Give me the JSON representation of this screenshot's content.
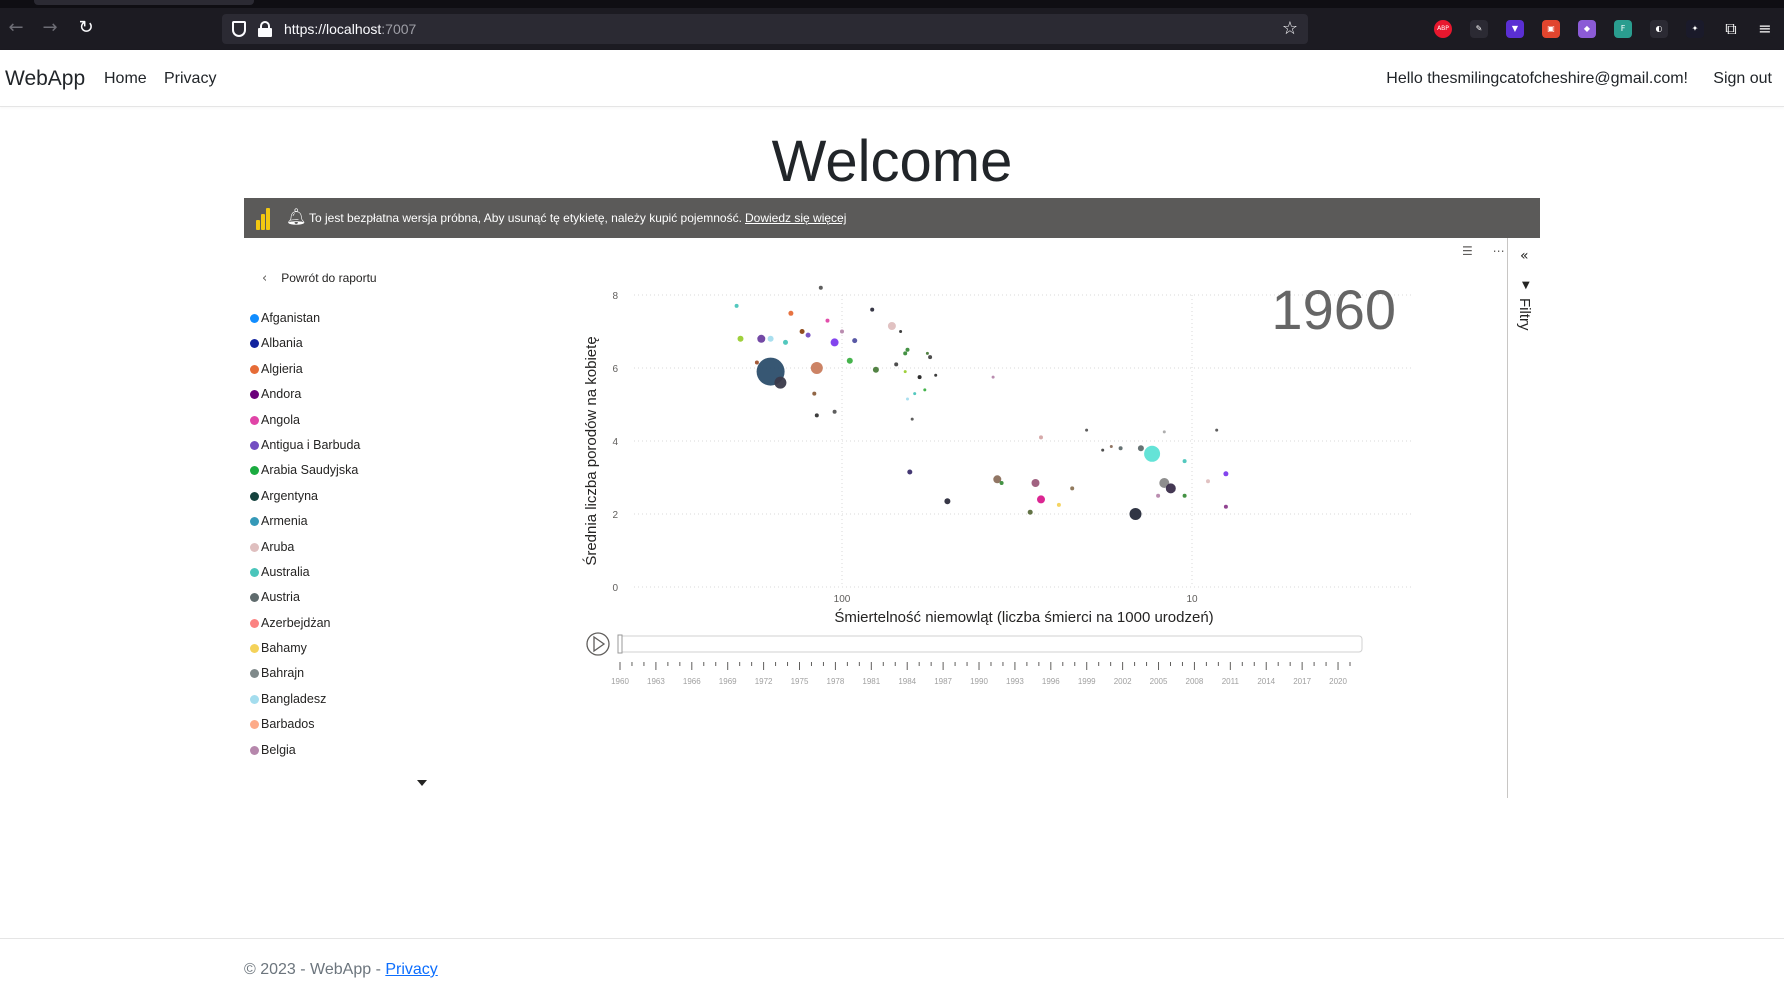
{
  "browser": {
    "url_host": "https://localhost",
    "url_port": ":7007",
    "back_icon": "arrow-left-icon",
    "forward_icon": "arrow-right-icon",
    "reload_icon": "reload-icon",
    "extensions": [
      {
        "name": "adblock-plus-icon",
        "label": "ABP",
        "color": "#e8172e"
      },
      {
        "name": "pen-icon",
        "label": "✎",
        "color": "#2b2a33"
      },
      {
        "name": "proton-icon",
        "label": "▼",
        "color": "#5a2fd3"
      },
      {
        "name": "screenshot-icon",
        "label": "▣",
        "color": "#e1452e"
      },
      {
        "name": "cube-icon",
        "label": "◆",
        "color": "#8b5bd6"
      },
      {
        "name": "shield-f-icon",
        "label": "F",
        "color": "#2a9d8f"
      },
      {
        "name": "circle-arrow-icon",
        "label": "◐",
        "color": "#2b2a33"
      },
      {
        "name": "sparkle-icon",
        "label": "✦",
        "color": "#1a1a2a"
      },
      {
        "name": "puzzle-icon",
        "label": "⧉",
        "color": "#1c1b22"
      },
      {
        "name": "menu-icon",
        "label": "≡",
        "color": "#1c1b22"
      }
    ]
  },
  "navbar": {
    "brand": "WebApp",
    "links": [
      "Home",
      "Privacy"
    ],
    "greeting": "Hello thesmilingcatofcheshire@gmail.com!",
    "signout": "Sign out"
  },
  "page": {
    "title": "Welcome"
  },
  "report": {
    "banner_message": "To jest bezpłatna wersja próbna, Aby usunąć tę etykietę, należy kupić pojemność.",
    "banner_link": "Dowiedz się więcej",
    "back_label": "Powrót do raportu",
    "filters_label": "Filtry",
    "legend": [
      {
        "name": "Afganistan",
        "color": "#118dff"
      },
      {
        "name": "Albania",
        "color": "#12239e"
      },
      {
        "name": "Algieria",
        "color": "#e66c37"
      },
      {
        "name": "Andora",
        "color": "#6b007b"
      },
      {
        "name": "Angola",
        "color": "#e044a7"
      },
      {
        "name": "Antigua i Barbuda",
        "color": "#744ec2"
      },
      {
        "name": "Arabia Saudyjska",
        "color": "#1aab40"
      },
      {
        "name": "Argentyna",
        "color": "#15433e"
      },
      {
        "name": "Armenia",
        "color": "#3599b8"
      },
      {
        "name": "Aruba",
        "color": "#dfbfbf"
      },
      {
        "name": "Australia",
        "color": "#4ac5bb"
      },
      {
        "name": "Austria",
        "color": "#5f6b6d"
      },
      {
        "name": "Azerbejdżan",
        "color": "#fb8281"
      },
      {
        "name": "Bahamy",
        "color": "#f4d25a"
      },
      {
        "name": "Bahrajn",
        "color": "#7f898a"
      },
      {
        "name": "Bangladesz",
        "color": "#a4ddee"
      },
      {
        "name": "Barbados",
        "color": "#fdab89"
      },
      {
        "name": "Belgia",
        "color": "#b687ac"
      }
    ]
  },
  "chart_data": {
    "type": "scatter",
    "year_label": "1960",
    "xlabel": "Śmiertelność niemowląt (liczba śmierci na 1000 urodzeń)",
    "ylabel": "Średnia liczba porodów na kobietę",
    "x_scale": "log (reversed)",
    "x_ticks": [
      "100",
      "10"
    ],
    "y_ticks": [
      "0",
      "2",
      "4",
      "6",
      "8"
    ],
    "ylim": [
      0,
      8
    ],
    "xlim_note": "reversed log axis, approx 300 to 1.3",
    "timeline_years": [
      "1960",
      "1963",
      "1966",
      "1969",
      "1972",
      "1975",
      "1978",
      "1981",
      "1984",
      "1987",
      "1990",
      "1993",
      "1996",
      "1999",
      "2002",
      "2005",
      "2008",
      "2011",
      "2014",
      "2017",
      "2020"
    ],
    "points": [
      {
        "x": 160,
        "y": 5.9,
        "r": 14,
        "c": "#2c4e6b"
      },
      {
        "x": 150,
        "y": 5.6,
        "r": 6,
        "c": "#3a3a4a"
      },
      {
        "x": 118,
        "y": 6.0,
        "r": 6,
        "c": "#c97c5d"
      },
      {
        "x": 170,
        "y": 6.8,
        "r": 4,
        "c": "#6b3fa0"
      },
      {
        "x": 195,
        "y": 6.8,
        "r": 3,
        "c": "#9acd32"
      },
      {
        "x": 160,
        "y": 6.8,
        "r": 3,
        "c": "#a4ddee"
      },
      {
        "x": 105,
        "y": 6.7,
        "r": 4,
        "c": "#7c3aed"
      },
      {
        "x": 95,
        "y": 6.2,
        "r": 3,
        "c": "#3cb043"
      },
      {
        "x": 80,
        "y": 5.95,
        "r": 3,
        "c": "#4a7c3a"
      },
      {
        "x": 72,
        "y": 7.15,
        "r": 4,
        "c": "#dfbfbf"
      },
      {
        "x": 92,
        "y": 6.75,
        "r": 2.5,
        "c": "#5050a0"
      },
      {
        "x": 140,
        "y": 7.5,
        "r": 2.5,
        "c": "#e66c37"
      },
      {
        "x": 115,
        "y": 8.2,
        "r": 2,
        "c": "#555"
      },
      {
        "x": 130,
        "y": 7.0,
        "r": 2.5,
        "c": "#8b4513"
      },
      {
        "x": 145,
        "y": 6.7,
        "r": 2.5,
        "c": "#4ac5bb"
      },
      {
        "x": 125,
        "y": 6.9,
        "r": 2.5,
        "c": "#744ec2"
      },
      {
        "x": 110,
        "y": 7.3,
        "r": 2,
        "c": "#e044a7"
      },
      {
        "x": 100,
        "y": 7.0,
        "r": 2,
        "c": "#b687ac"
      },
      {
        "x": 82,
        "y": 7.6,
        "r": 2,
        "c": "#2c2c3c"
      },
      {
        "x": 120,
        "y": 5.3,
        "r": 2,
        "c": "#8b5e3c"
      },
      {
        "x": 118,
        "y": 4.7,
        "r": 2,
        "c": "#333"
      },
      {
        "x": 105,
        "y": 4.8,
        "r": 2,
        "c": "#555"
      },
      {
        "x": 200,
        "y": 7.7,
        "r": 2,
        "c": "#4ac5bb"
      },
      {
        "x": 175,
        "y": 6.15,
        "r": 2,
        "c": "#a0522d"
      },
      {
        "x": 70,
        "y": 6.1,
        "r": 2,
        "c": "#444"
      },
      {
        "x": 62,
        "y": 5.3,
        "r": 1.5,
        "c": "#4ac5bb"
      },
      {
        "x": 66,
        "y": 5.9,
        "r": 1.5,
        "c": "#9acd32"
      },
      {
        "x": 60,
        "y": 5.75,
        "r": 2,
        "c": "#222"
      },
      {
        "x": 58,
        "y": 5.4,
        "r": 1.5,
        "c": "#3cb043"
      },
      {
        "x": 65,
        "y": 6.5,
        "r": 2,
        "c": "#3a8c3a"
      },
      {
        "x": 63,
        "y": 4.6,
        "r": 1.5,
        "c": "#555"
      },
      {
        "x": 20,
        "y": 4.3,
        "r": 1.5,
        "c": "#555"
      },
      {
        "x": 37,
        "y": 5.75,
        "r": 1.5,
        "c": "#b687ac"
      },
      {
        "x": 13,
        "y": 3.65,
        "r": 8,
        "c": "#5ce1d5"
      },
      {
        "x": 14,
        "y": 3.8,
        "r": 3,
        "c": "#5f6b6d"
      },
      {
        "x": 12,
        "y": 2.85,
        "r": 5,
        "c": "#888"
      },
      {
        "x": 11.5,
        "y": 2.7,
        "r": 5,
        "c": "#3a2d4a"
      },
      {
        "x": 14.5,
        "y": 2.0,
        "r": 6,
        "c": "#252a3a"
      },
      {
        "x": 50,
        "y": 2.35,
        "r": 3,
        "c": "#2c2c3c"
      },
      {
        "x": 36,
        "y": 2.95,
        "r": 4,
        "c": "#8b6f5c"
      },
      {
        "x": 28,
        "y": 2.85,
        "r": 4,
        "c": "#9c5a7a"
      },
      {
        "x": 27,
        "y": 2.4,
        "r": 4,
        "c": "#d91a8c"
      },
      {
        "x": 29,
        "y": 2.05,
        "r": 2.5,
        "c": "#5a6b3c"
      },
      {
        "x": 64,
        "y": 3.15,
        "r": 2.5,
        "c": "#3a2d6b"
      },
      {
        "x": 22,
        "y": 2.7,
        "r": 2,
        "c": "#8b7355"
      },
      {
        "x": 24,
        "y": 2.25,
        "r": 2,
        "c": "#f4d25a"
      },
      {
        "x": 35,
        "y": 2.85,
        "r": 2,
        "c": "#3a8c3a"
      },
      {
        "x": 12.5,
        "y": 2.5,
        "r": 2,
        "c": "#b687ac"
      },
      {
        "x": 8,
        "y": 3.1,
        "r": 2.5,
        "c": "#7c3aed"
      },
      {
        "x": 8,
        "y": 2.2,
        "r": 2,
        "c": "#8b3a8b"
      },
      {
        "x": 9,
        "y": 2.9,
        "r": 2,
        "c": "#dfbfbf"
      },
      {
        "x": 10.5,
        "y": 3.45,
        "r": 2,
        "c": "#4ac5bb"
      },
      {
        "x": 10.5,
        "y": 2.5,
        "r": 2,
        "c": "#3a8c3a"
      },
      {
        "x": 8.5,
        "y": 4.3,
        "r": 1.5,
        "c": "#555"
      },
      {
        "x": 12,
        "y": 4.25,
        "r": 1.5,
        "c": "#aaa"
      },
      {
        "x": 27,
        "y": 4.1,
        "r": 2,
        "c": "#d4a5a5"
      },
      {
        "x": 18,
        "y": 3.75,
        "r": 1.5,
        "c": "#444"
      },
      {
        "x": 17,
        "y": 3.85,
        "r": 1.5,
        "c": "#8b6f5c"
      },
      {
        "x": 16,
        "y": 3.8,
        "r": 2,
        "c": "#5f6b6d"
      },
      {
        "x": 68,
        "y": 7.0,
        "r": 1.5,
        "c": "#333"
      },
      {
        "x": 66,
        "y": 6.4,
        "r": 2,
        "c": "#3a8c3a"
      },
      {
        "x": 56,
        "y": 6.3,
        "r": 2,
        "c": "#444"
      },
      {
        "x": 54,
        "y": 5.8,
        "r": 1.5,
        "c": "#333"
      },
      {
        "x": 57,
        "y": 6.4,
        "r": 1.5,
        "c": "#4a7c3a"
      },
      {
        "x": 65,
        "y": 5.15,
        "r": 1.5,
        "c": "#a4ddee"
      }
    ]
  }
}
